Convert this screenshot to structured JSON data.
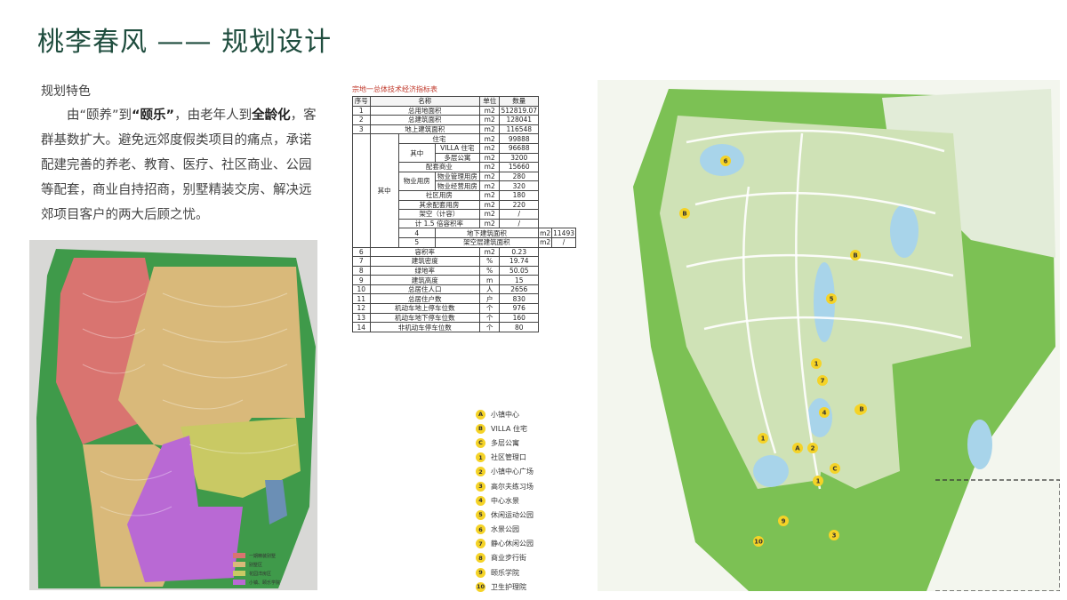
{
  "page": {
    "title": "桃李春风 —— 规划设计",
    "section_head": "规划特色",
    "para": {
      "p1": "由“颐养”到",
      "b1": "“颐乐”",
      "p2": "，由老年人到",
      "b2": "全龄化",
      "p3": "，客群基数扩大。避免远郊度假类项目的痛点，承诺配建完善的养老、教育、医疗、社区商业、公园等配套，商业自持招商，别墅精装交房、解决远郊项目客户的两大后顾之忧。"
    }
  },
  "left_map": {
    "legend": [
      {
        "label": "一期精装别墅",
        "color": "#d97470"
      },
      {
        "label": "别墅区",
        "color": "#d9b97a"
      },
      {
        "label": "花园洋房区",
        "color": "#c9c964"
      },
      {
        "label": "小镇、颐乐学院",
        "color": "#b969d4"
      }
    ]
  },
  "table": {
    "title": "宗地一总体技术经济指标表",
    "headers": [
      "序号",
      "名称",
      "单位",
      "数量"
    ],
    "rows": {
      "r1": {
        "no": "1",
        "name": "总用地面积",
        "unit": "m2",
        "val": "512819.07"
      },
      "r2": {
        "no": "2",
        "name": "总建筑面积",
        "unit": "m2",
        "val": "128041"
      },
      "r3": {
        "no": "3",
        "name": "地上建筑面积",
        "unit": "m2",
        "val": "116548"
      },
      "qizhong": "其中",
      "zhuzhai": {
        "name": "住宅",
        "unit": "m2",
        "val": "99888"
      },
      "qizhong2": "其中",
      "villa": {
        "name": "VILLA 住宅",
        "unit": "m2",
        "val": "96688"
      },
      "duoceng": {
        "name": "多层公寓",
        "unit": "m2",
        "val": "3200"
      },
      "peitao": {
        "name": "配套商业",
        "unit": "m2",
        "val": "15660"
      },
      "wuye": "物业用房",
      "wuye_gl": {
        "name": "物业管理用房",
        "unit": "m2",
        "val": "280"
      },
      "wuye_jy": {
        "name": "物业经营用房",
        "unit": "m2",
        "val": "320"
      },
      "shequ": {
        "name": "社区用房",
        "unit": "m2",
        "val": "180"
      },
      "qiyu": {
        "name": "其余配套用房",
        "unit": "m2",
        "val": "220"
      },
      "jiakong": {
        "name": "架空（计容）",
        "unit": "m2",
        "val": "/"
      },
      "ji15": {
        "name": "计 1.5 倍容积率",
        "unit": "m2",
        "val": "/"
      },
      "r4": {
        "no": "4",
        "name": "地下建筑面积",
        "unit": "m2",
        "val": "11493"
      },
      "r5": {
        "no": "5",
        "name": "架空层建筑面积",
        "unit": "m2",
        "val": "/"
      },
      "r6": {
        "no": "6",
        "name": "容积率",
        "unit": "m2",
        "val": "0.23"
      },
      "r7": {
        "no": "7",
        "name": "建筑密度",
        "unit": "%",
        "val": "19.74"
      },
      "r8": {
        "no": "8",
        "name": "绿地率",
        "unit": "%",
        "val": "50.05"
      },
      "r9": {
        "no": "9",
        "name": "建筑高度",
        "unit": "m",
        "val": "15"
      },
      "r10": {
        "no": "10",
        "name": "总居住人口",
        "unit": "人",
        "val": "2656"
      },
      "r11": {
        "no": "11",
        "name": "总居住户数",
        "unit": "户",
        "val": "830"
      },
      "r12": {
        "no": "12",
        "name": "机动车地上停车位数",
        "unit": "个",
        "val": "976"
      },
      "r13": {
        "no": "13",
        "name": "机动车地下停车位数",
        "unit": "个",
        "val": "160"
      },
      "r14": {
        "no": "14",
        "name": "非机动车停车位数",
        "unit": "个",
        "val": "80"
      }
    }
  },
  "right_map": {
    "legend": [
      {
        "badge": "A",
        "label": "小镇中心"
      },
      {
        "badge": "B",
        "label": "VILLA 住宅"
      },
      {
        "badge": "C",
        "label": "多层公寓"
      },
      {
        "badge": "1",
        "label": "社区管理口"
      },
      {
        "badge": "2",
        "label": "小镇中心广场"
      },
      {
        "badge": "3",
        "label": "高尔夫练习场"
      },
      {
        "badge": "4",
        "label": "中心水景"
      },
      {
        "badge": "5",
        "label": "休闲运动公园"
      },
      {
        "badge": "6",
        "label": "水景公园"
      },
      {
        "badge": "7",
        "label": "静心休闲公园"
      },
      {
        "badge": "8",
        "label": "商业步行街"
      },
      {
        "badge": "9",
        "label": "颐乐学院"
      },
      {
        "badge": "10",
        "label": "卫生护理院"
      }
    ],
    "labels": [
      "6",
      "B",
      "B",
      "5",
      "8",
      "1",
      "7",
      "4",
      "B",
      "1",
      "A",
      "2",
      "C",
      "1",
      "9",
      "10",
      "3"
    ]
  }
}
